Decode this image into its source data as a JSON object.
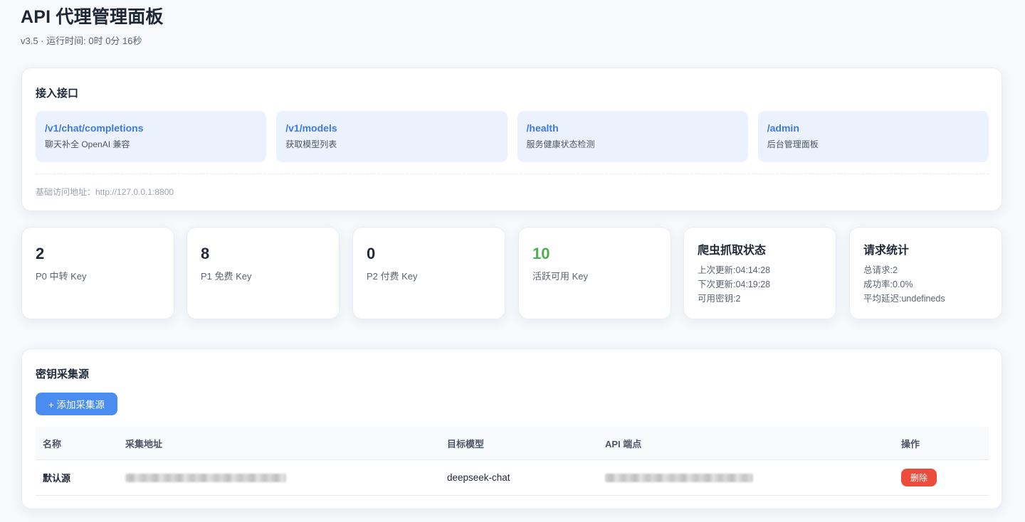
{
  "header": {
    "title": "API 代理管理面板",
    "subtitle": "v3.5 · 运行时间: 0时 0分 16秒"
  },
  "endpoints": {
    "title": "接入接口",
    "items": [
      {
        "path": "/v1/chat/completions",
        "desc": "聊天补全 OpenAI 兼容"
      },
      {
        "path": "/v1/models",
        "desc": "获取模型列表"
      },
      {
        "path": "/health",
        "desc": "服务健康状态检测"
      },
      {
        "path": "/admin",
        "desc": "后台管理面板"
      }
    ],
    "base_url": "基础访问地址：http://127.0.0.1:8800"
  },
  "stats": [
    {
      "value": "2",
      "label": "P0 中转 Key"
    },
    {
      "value": "8",
      "label": "P1 免费 Key"
    },
    {
      "value": "0",
      "label": "P2 付费 Key"
    },
    {
      "value": "10",
      "label": "活跃可用 Key",
      "color": "#4caf50"
    }
  ],
  "crawler": {
    "title": "爬虫抓取状态",
    "lines": [
      "上次更新:04:14:28",
      "下次更新:04:19:28",
      "可用密钥:2"
    ]
  },
  "requests": {
    "title": "请求统计",
    "lines": [
      "总请求:2",
      "成功率:0.0%",
      "平均延迟:undefineds"
    ]
  },
  "sources": {
    "title": "密钥采集源",
    "add_label": "+ 添加采集源",
    "columns": [
      "名称",
      "采集地址",
      "目标模型",
      "API 端点",
      "操作"
    ],
    "rows": [
      {
        "name": "默认源",
        "model": "deepseek-chat",
        "action": "删除"
      }
    ]
  },
  "colors": {
    "accent": "#3b7be0",
    "button": "#4a8cf0",
    "danger": "#ec4c3c",
    "success": "#4caf50"
  }
}
